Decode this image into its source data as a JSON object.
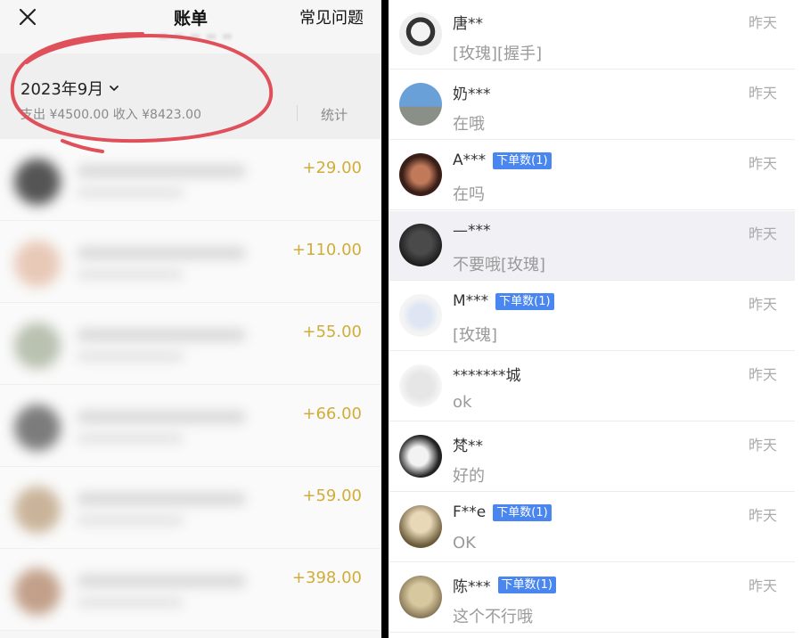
{
  "bill": {
    "title": "账单",
    "faq": "常见问题",
    "month": "2023年9月",
    "totals": "支出 ¥4500.00 收入 ¥8423.00",
    "stats": "统计",
    "rows": [
      {
        "amount": "+29.00"
      },
      {
        "amount": "+110.00"
      },
      {
        "amount": "+55.00"
      },
      {
        "amount": "+66.00"
      },
      {
        "amount": "+59.00"
      },
      {
        "amount": "+398.00"
      }
    ]
  },
  "chats": [
    {
      "name": "唐**",
      "badge": "",
      "message": "[玫瑰][握手]",
      "time": "昨天"
    },
    {
      "name": "奶***",
      "badge": "",
      "message": "在哦",
      "time": "昨天"
    },
    {
      "name": "A***",
      "badge": "下单数(1)",
      "message": "在吗",
      "time": "昨天"
    },
    {
      "name": "—***",
      "badge": "",
      "message": "不要哦[玫瑰]",
      "time": "昨天"
    },
    {
      "name": "M***",
      "badge": "下单数(1)",
      "message": "[玫瑰]",
      "time": "昨天"
    },
    {
      "name": "*******城",
      "badge": "",
      "message": "ok",
      "time": "昨天"
    },
    {
      "name": "梵**",
      "badge": "",
      "message": "好的",
      "time": "昨天"
    },
    {
      "name": "F**e",
      "badge": "下单数(1)",
      "message": "OK",
      "time": "昨天"
    },
    {
      "name": "陈***",
      "badge": "下单数(1)",
      "message": "这个不行哦",
      "time": "昨天"
    }
  ],
  "colors": {
    "amount": "#d0ad3a",
    "badge": "#4a86f0",
    "annotation_circle": "#e0505a"
  },
  "icons": [
    "close-icon",
    "chevron-down-icon"
  ]
}
